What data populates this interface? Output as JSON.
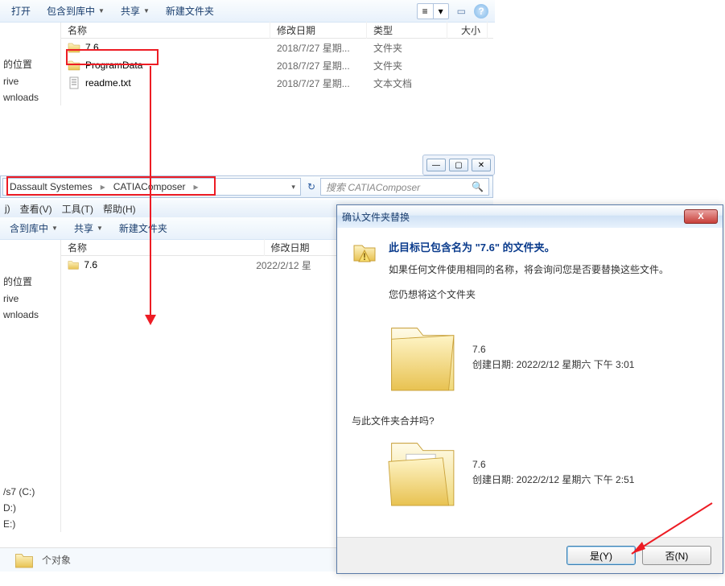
{
  "toolbar": {
    "open": "打开",
    "include": "包含到库中",
    "share": "共享",
    "newfolder": "新建文件夹"
  },
  "columns": {
    "name": "名称",
    "date": "修改日期",
    "type": "类型",
    "size": "大小"
  },
  "files_top": [
    {
      "name": "7.6",
      "date": "2018/7/27 星期...",
      "type": "文件夹",
      "icon": "folder"
    },
    {
      "name": "ProgramData",
      "date": "2018/7/27 星期...",
      "type": "文件夹",
      "icon": "folder"
    },
    {
      "name": "readme.txt",
      "date": "2018/7/27 星期...",
      "type": "文本文档",
      "icon": "txt"
    }
  ],
  "sidebar_labels": {
    "loc": "的位置",
    "drive": "rive",
    "downloads": "wnloads"
  },
  "breadcrumb": {
    "p1": "Dassault Systemes",
    "p2": "CATIAComposer"
  },
  "search_placeholder": "搜索 CATIAComposer",
  "menu2": {
    "view": "查看(V)",
    "tools": "工具(T)",
    "help": "帮助(H)",
    "editpre": "j)"
  },
  "toolbar2": {
    "include": "含到库中",
    "share": "共享",
    "newfolder": "新建文件夹"
  },
  "files_bottom": [
    {
      "name": "7.6",
      "date": "2022/2/12 星",
      "icon": "folder"
    }
  ],
  "sidebar2_extra": {
    "c": "/s7 (C:)",
    "d": "D:)",
    "e": "E:)"
  },
  "status": "个对象",
  "dialog": {
    "title": "确认文件夹替换",
    "headline": "此目标已包含名为 \"7.6\" 的文件夹。",
    "explain": "如果任何文件使用相同的名称，将会询问您是否要替换这些文件。",
    "keep": "您仍想将这个文件夹",
    "merge": "与此文件夹合并吗?",
    "f1_name": "7.6",
    "f1_date": "创建日期: 2022/2/12 星期六 下午 3:01",
    "f2_name": "7.6",
    "f2_date": "创建日期: 2022/2/12 星期六 下午 2:51",
    "yes": "是(Y)",
    "no": "否(N)"
  }
}
